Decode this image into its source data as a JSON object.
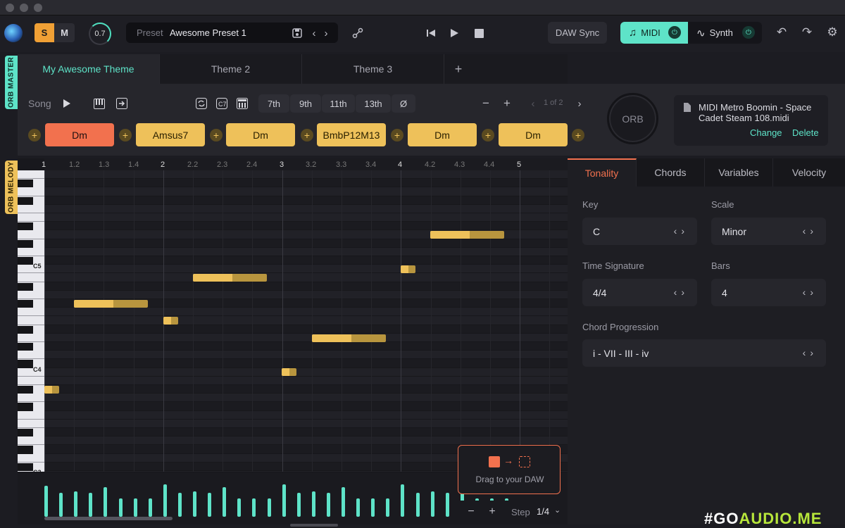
{
  "toolbar": {
    "solo_label": "S",
    "mute_label": "M",
    "knob_value": "0.7",
    "preset_label": "Preset",
    "preset_name": "Awesome Preset 1",
    "daw_sync_label": "DAW Sync",
    "midi_label": "MIDI",
    "synth_label": "Synth"
  },
  "side_tabs": {
    "master": "ORB MASTER",
    "melody": "ORB MELODY"
  },
  "theme_tabs": [
    "My Awesome Theme",
    "Theme 2",
    "Theme 3"
  ],
  "theme_add": "+",
  "song": {
    "song_label": "Song",
    "extensions": [
      "7th",
      "9th",
      "11th",
      "13th",
      "Ø"
    ],
    "page_indicator": "1 of 2",
    "minus": "−",
    "plus": "+",
    "chords": [
      "Dm",
      "Amsus7",
      "Dm",
      "BmbP12M13",
      "Dm",
      "Dm"
    ],
    "active_chord_index": 0,
    "orb_label": "ORB"
  },
  "midi_file": {
    "name": "MIDI Metro Boomin - Space Cadet Steam 108.midi",
    "line1": "MIDI Metro Boomin - Space",
    "line2": "Cadet Steam 108.midi",
    "change": "Change",
    "delete": "Delete"
  },
  "ruler": {
    "bars": [
      "1",
      "2",
      "3",
      "4",
      "5"
    ],
    "sub": [
      "1.2",
      "1.3",
      "1.4",
      "2.2",
      "2.3",
      "2.4",
      "3.2",
      "3.3",
      "3.4",
      "4.2",
      "4.3",
      "4.4"
    ]
  },
  "piano_labels": {
    "c5": "C5",
    "c4": "C4",
    "c3": "C3"
  },
  "drag_card": {
    "label": "Drag to your DAW"
  },
  "step": {
    "label": "Step",
    "value": "1/4",
    "minus": "−",
    "plus": "+"
  },
  "right_panel": {
    "tabs": [
      "Tonality",
      "Chords",
      "Variables",
      "Velocity"
    ],
    "key_label": "Key",
    "key_value": "C",
    "scale_label": "Scale",
    "scale_value": "Minor",
    "time_sig_label": "Time Signature",
    "time_sig_value": "4/4",
    "bars_label": "Bars",
    "bars_value": "4",
    "progression_label": "Chord Progression",
    "progression_value": "i - VII - III - iv"
  },
  "watermark": {
    "prefix": "#GO",
    "suffix": "AUDIO.ME"
  },
  "colors": {
    "accent_teal": "#5ee3c8",
    "accent_orange": "#f2714e",
    "chord_yellow": "#eec15a",
    "solo_orange": "#f0a035"
  }
}
